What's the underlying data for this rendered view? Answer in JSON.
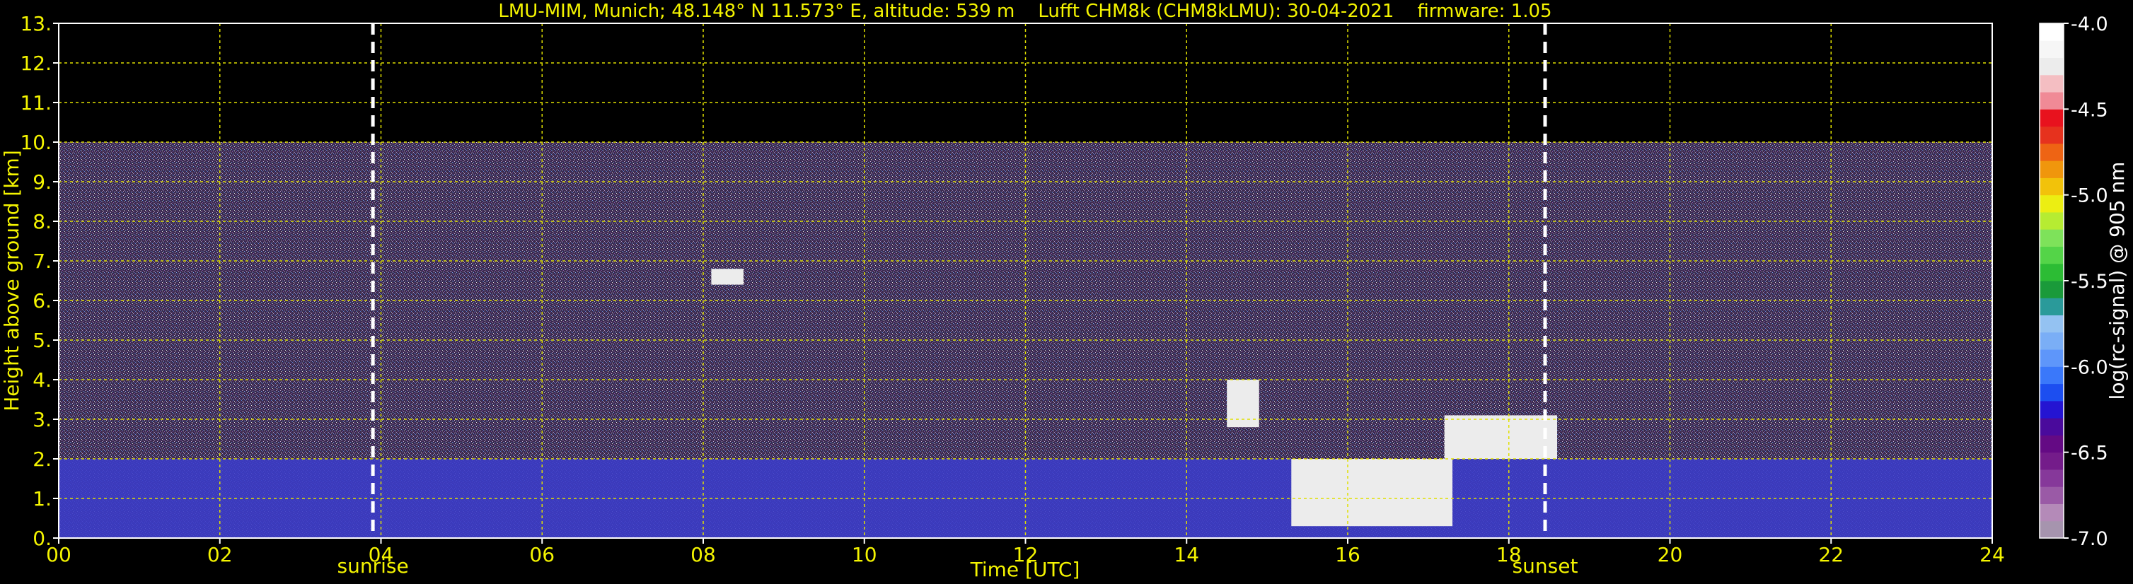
{
  "chart_data": {
    "type": "heatmap",
    "title": "LMU-MIM, Munich; 48.148° N 11.573° E, altitude: 539 m    Lufft CHM8k (CHM8kLMU): 30-04-2021    firmware: 1.05",
    "xlabel": "Time [UTC]",
    "ylabel": "Height above ground [km]",
    "xlim": [
      0,
      24
    ],
    "ylim": [
      0,
      13
    ],
    "x_ticks": [
      "00",
      "02",
      "04",
      "06",
      "08",
      "10",
      "12",
      "14",
      "16",
      "18",
      "20",
      "22",
      "24"
    ],
    "y_ticks": [
      "0.",
      "1.",
      "2.",
      "3.",
      "4.",
      "5.",
      "6.",
      "7.",
      "8.",
      "9.",
      "10.",
      "11.",
      "12.",
      "13."
    ],
    "grid": true,
    "markers": [
      {
        "label": "sunrise",
        "time": 3.9
      },
      {
        "label": "sunset",
        "time": 18.45
      }
    ],
    "colorbar": {
      "label": "log(rc-signal) @ 905 nm",
      "range": [
        -7.0,
        -4.0
      ],
      "ticks": [
        "-4.0",
        "-4.5",
        "-5.0",
        "-5.5",
        "-6.0",
        "-6.5",
        "-7.0"
      ],
      "colors": [
        "#a694ae",
        "#b48ab8",
        "#9a5aa6",
        "#86389a",
        "#741c8a",
        "#640a84",
        "#4a0a9c",
        "#2414d2",
        "#1c4ef0",
        "#3a78fa",
        "#5e96fa",
        "#7aaef6",
        "#94c2f2",
        "#2a9a9a",
        "#1a9a3a",
        "#2cbc34",
        "#54d448",
        "#7ee25a",
        "#b6ec32",
        "#ecee12",
        "#f2c20a",
        "#f0960c",
        "#ee6414",
        "#e6321e",
        "#e8121e",
        "#f08a96",
        "#f4bec2",
        "#ececec",
        "#f6f6f6",
        "#ffffff"
      ]
    },
    "layers": [
      {
        "name": "noise",
        "x": [
          0,
          24
        ],
        "y": [
          0,
          10
        ]
      },
      {
        "name": "boundary layer",
        "x": [
          0,
          24
        ],
        "y": [
          0,
          2.0
        ]
      },
      {
        "name": "cloud",
        "x": [
          8.1,
          8.5
        ],
        "y": [
          6.4,
          6.8
        ]
      },
      {
        "name": "cloud",
        "x": [
          14.5,
          14.9
        ],
        "y": [
          2.8,
          4.0
        ]
      },
      {
        "name": "cloud",
        "x": [
          15.3,
          17.3
        ],
        "y": [
          0.3,
          2.0
        ]
      },
      {
        "name": "cloud",
        "x": [
          17.2,
          18.6
        ],
        "y": [
          2.0,
          3.1
        ]
      }
    ]
  }
}
